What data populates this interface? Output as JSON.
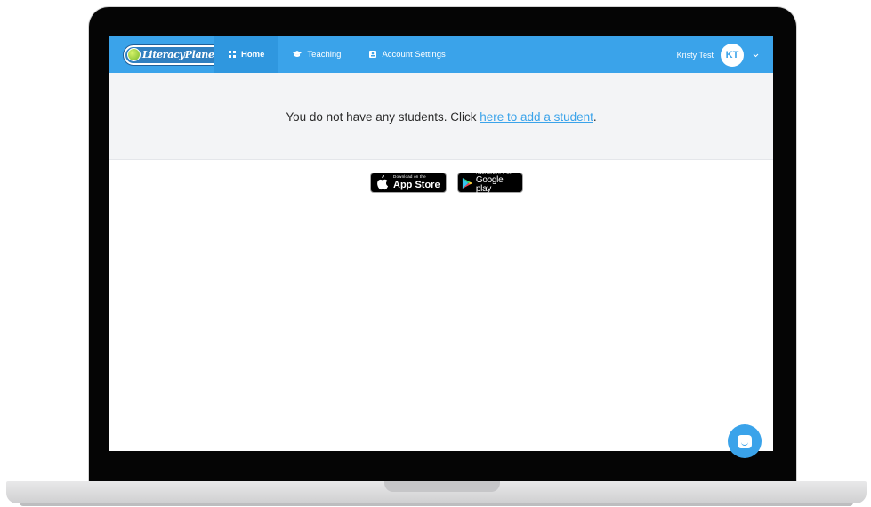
{
  "app": {
    "logo_text": "LiteracyPlanet"
  },
  "nav": {
    "items": [
      {
        "label": "Home",
        "icon": "grid-icon",
        "active": true
      },
      {
        "label": "Teaching",
        "icon": "graduation-cap-icon",
        "active": false
      },
      {
        "label": "Account Settings",
        "icon": "id-card-icon",
        "active": false
      }
    ],
    "user_name": "Kristy Test",
    "user_initials": "KT"
  },
  "banner": {
    "message_prefix": "You do not have any students. Click ",
    "link_text": "here to add a student",
    "message_suffix": "."
  },
  "badges": {
    "appstore_small": "Download on the",
    "appstore_big": "App Store",
    "google_small": "ANDROID APP ON",
    "google_big": "Google play"
  },
  "colors": {
    "accent": "#3aa3ea",
    "banner_bg": "#f3f4f6",
    "link": "#3aa3ea"
  }
}
